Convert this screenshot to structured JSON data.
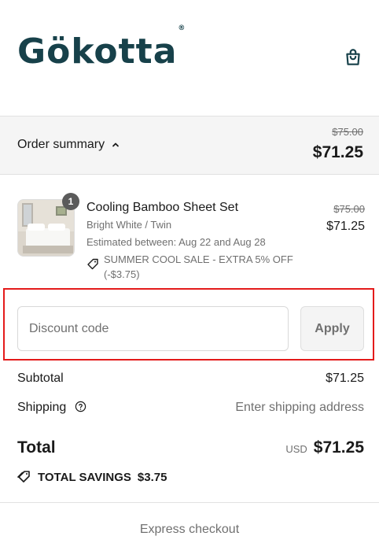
{
  "header": {
    "logo_text": "Gökotta",
    "logo_mark": "®",
    "cart_icon": "shopping-bag-icon"
  },
  "summary": {
    "toggle_label": "Order summary",
    "chevron_icon": "chevron-up-icon",
    "original_total": "$75.00",
    "total": "$71.25"
  },
  "product": {
    "quantity": "1",
    "name": "Cooling Bamboo Sheet Set",
    "variant": "Bright White / Twin",
    "delivery_estimate": "Estimated between: Aug 22 and Aug 28",
    "discount_line_1": "SUMMER COOL SALE - EXTRA 5% OFF",
    "discount_line_2": "(-$3.75)",
    "original_price": "$75.00",
    "price": "$71.25"
  },
  "discount": {
    "placeholder": "Discount code",
    "apply_label": "Apply"
  },
  "totals": {
    "subtotal_label": "Subtotal",
    "subtotal_value": "$71.25",
    "shipping_label": "Shipping",
    "shipping_value": "Enter shipping address",
    "total_label": "Total",
    "currency": "USD",
    "total_value": "$71.25",
    "savings_label": "TOTAL SAVINGS",
    "savings_value": "$3.75"
  },
  "express": {
    "label": "Express checkout"
  },
  "colors": {
    "brand": "#17414a",
    "highlight": "#e41b1b",
    "muted": "#707070"
  }
}
